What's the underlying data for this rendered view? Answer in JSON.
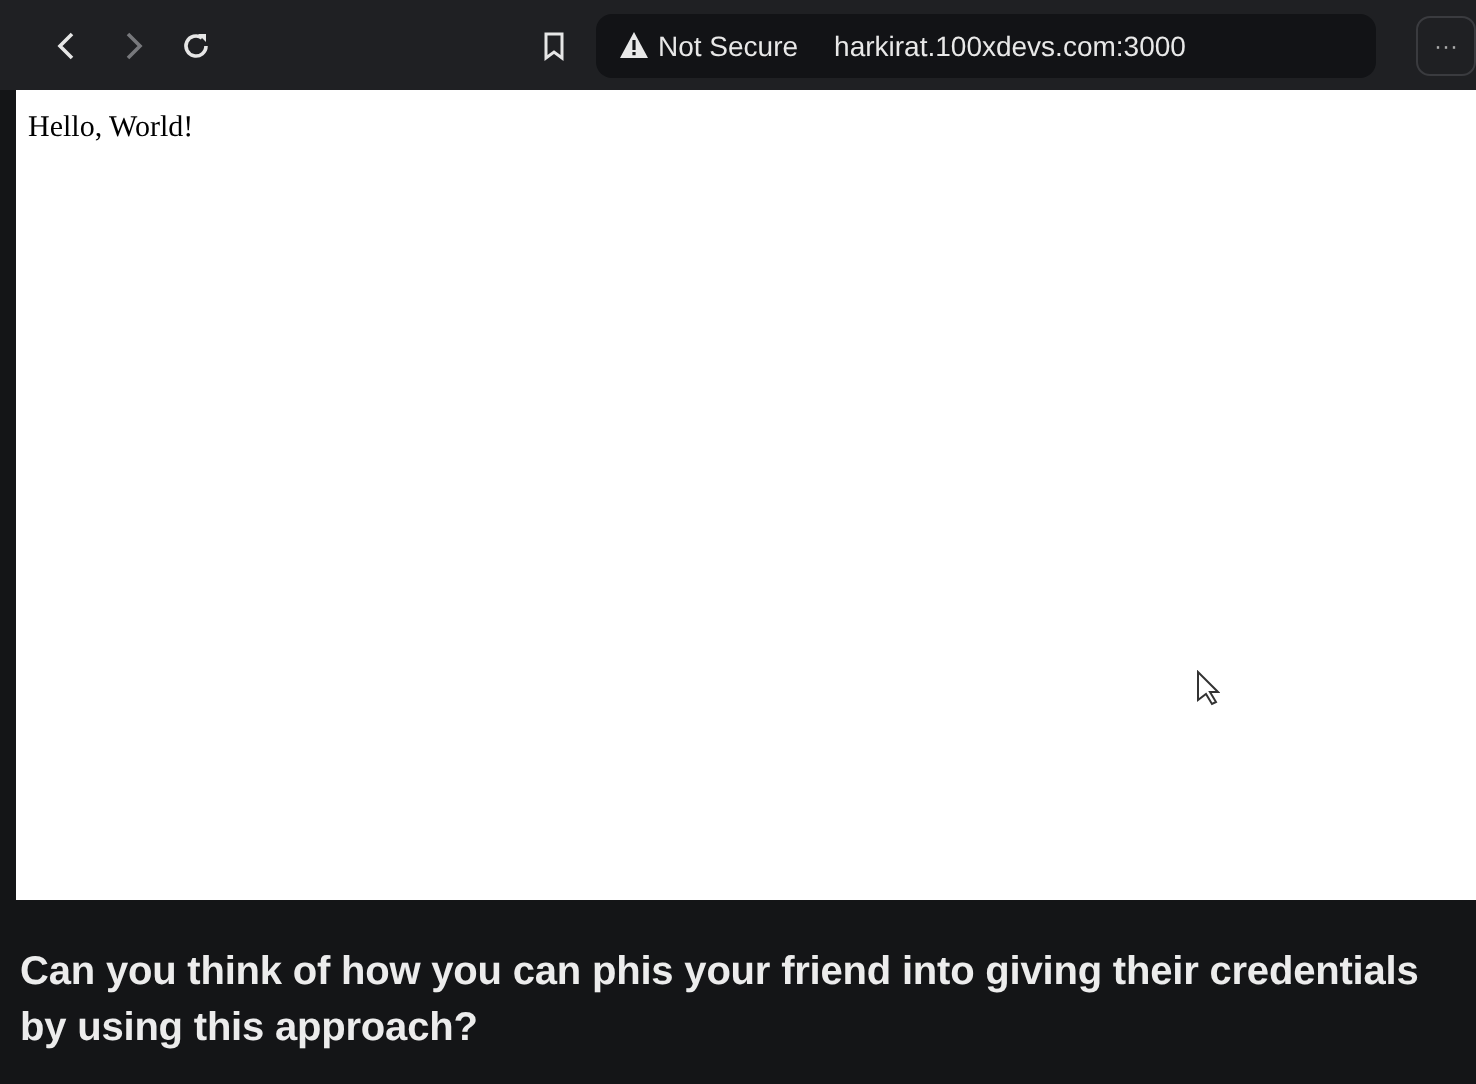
{
  "browser": {
    "security": "Not Secure",
    "url": "harkirat.100xdevs.com:3000",
    "menu": "···",
    "forward_disabled": true
  },
  "page": {
    "text": "Hello, World!"
  },
  "caption": "Can you think of how you can phis your friend into giving their credentials by using this approach?"
}
